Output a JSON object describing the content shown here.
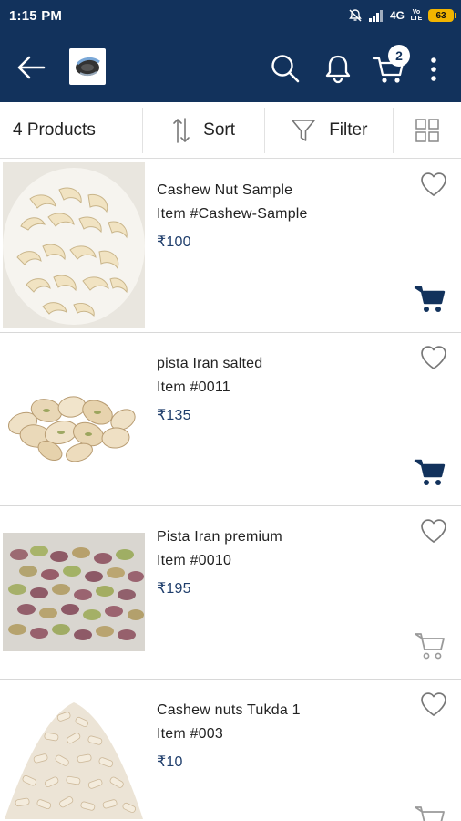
{
  "status_bar": {
    "time": "1:15 PM",
    "network": "4G",
    "volte": "Vo LTE",
    "battery": "63"
  },
  "app_bar": {
    "cart_count": "2"
  },
  "toolbar": {
    "product_count": "4 Products",
    "sort_label": "Sort",
    "filter_label": "Filter"
  },
  "products": [
    {
      "name": "Cashew Nut Sample",
      "sku": "Item #Cashew-Sample",
      "price": "₹100",
      "in_cart": true,
      "image": "cashew-whole"
    },
    {
      "name": "pista Iran salted",
      "sku": "Item #0011",
      "price": "₹135",
      "in_cart": true,
      "image": "pistachio-shelled"
    },
    {
      "name": "Pista Iran premium",
      "sku": "Item #0010",
      "price": "₹195",
      "in_cart": false,
      "image": "pistachio-kernels"
    },
    {
      "name": "Cashew nuts Tukda 1",
      "sku": "Item #003",
      "price": "₹10",
      "in_cart": false,
      "image": "cashew-pieces"
    }
  ],
  "colors": {
    "primary": "#12325c",
    "price": "#1e3d6b",
    "cart_filled": "#12325c",
    "cart_outline": "#9a9a9a"
  },
  "icons": [
    "back-arrow-icon",
    "search-icon",
    "bell-icon",
    "cart-icon",
    "more-vert-icon",
    "sort-icon",
    "filter-icon",
    "grid-view-icon",
    "heart-icon",
    "add-to-cart-icon"
  ]
}
